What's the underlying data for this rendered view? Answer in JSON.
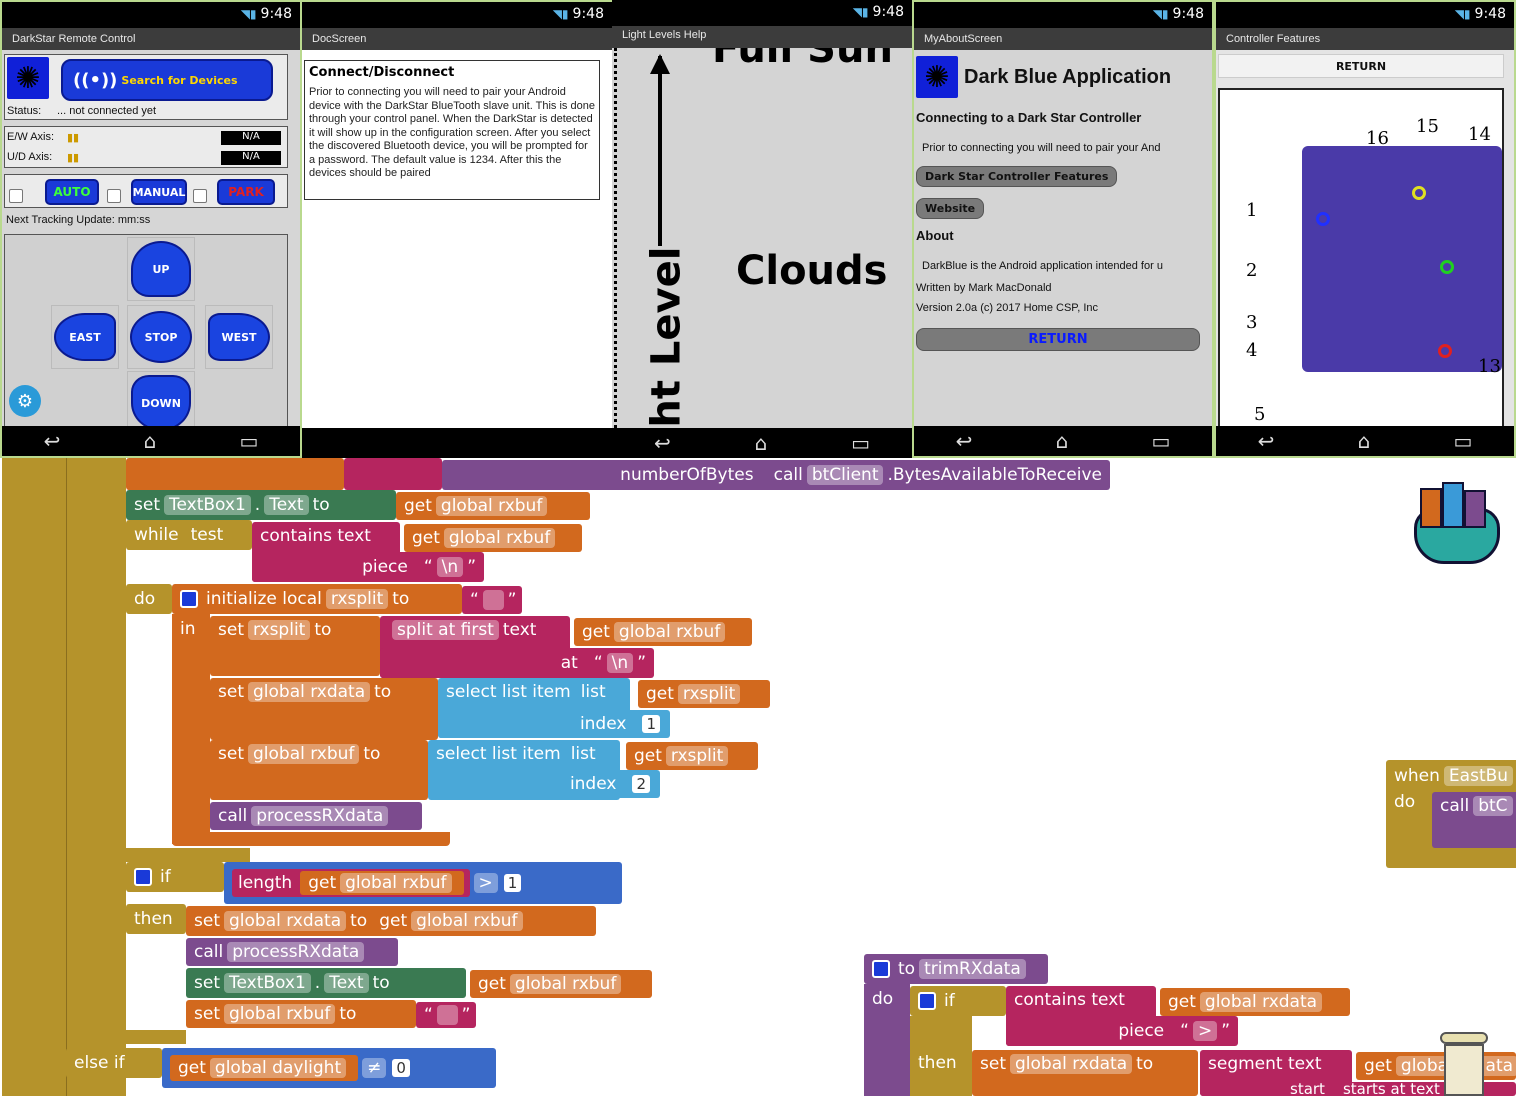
{
  "status_time": "9:48",
  "phones": {
    "remote": {
      "title": "DarkStar Remote Control",
      "search_label": "Search for Devices",
      "status_label": "Status:",
      "status_value": "... not connected yet",
      "ew_label": "E/W Axis:",
      "ud_label": "U/D Axis:",
      "ew_value": "N/A",
      "ud_value": "N/A",
      "auto_label": "AUTO",
      "manual_label": "MANUAL",
      "park_label": "PARK",
      "next_update": "Next Tracking Update: mm:ss",
      "up": "UP",
      "east": "EAST",
      "stop": "STOP",
      "west": "WEST",
      "down": "DOWN"
    },
    "doc": {
      "title": "DocScreen",
      "heading": "Connect/Disconnect",
      "body": "Prior to connecting you will need to pair your Android device with the DarkStar BlueTooth slave unit. This is done through your control panel. When the DarkStar is detected it will show up in the configuration screen. After you select the discovered Bluetooth device, you will be prompted for a password. The default value is 1234. After this the devices should be paired"
    },
    "light": {
      "title": "Light Levels Help",
      "top_text": "Full Sun",
      "clouds": "Clouds",
      "axis": "Light Level"
    },
    "about": {
      "title": "MyAboutScreen",
      "app_name": "Dark Blue Application",
      "connecting": "Connecting to a Dark Star Controller",
      "prior": "Prior to connecting you will need to pair your And",
      "features_btn": "Dark Star Controller Features",
      "website_btn": "Website",
      "about_head": "About",
      "about_body": "DarkBlue is the Android application intended for u",
      "written": "Written by Mark MacDonald",
      "version": "Version 2.0a (c) 2017 Home CSP, Inc",
      "return_btn": "RETURN"
    },
    "features": {
      "title": "Controller Features",
      "return_btn": "RETURN",
      "labels": [
        "1",
        "2",
        "3",
        "4",
        "5",
        "16",
        "15",
        "14",
        "13"
      ]
    }
  },
  "blocks": {
    "row0": [
      "numberOfBytes",
      "call",
      "btClient",
      ".BytesAvailableToReceive"
    ],
    "set_textbox": [
      "set",
      "TextBox1",
      ".",
      "Text",
      "to",
      "get",
      "global rxbuf"
    ],
    "while": [
      "while",
      "test",
      "contains text",
      "get",
      "global rxbuf"
    ],
    "piece": [
      "piece",
      "\\n"
    ],
    "do_init": [
      "do",
      "initialize local",
      "rxsplit",
      "to"
    ],
    "in_set": [
      "in",
      "set",
      "rxsplit",
      "to",
      "split at first",
      "text",
      "get",
      "global rxbuf"
    ],
    "at": [
      "at",
      "\\n"
    ],
    "set_rxdata": [
      "set",
      "global rxdata",
      "to",
      "select list item",
      "list",
      "get",
      "rxsplit"
    ],
    "index1": [
      "index",
      "1"
    ],
    "set_rxbuf": [
      "set",
      "global rxbuf",
      "to",
      "select list item",
      "list",
      "get",
      "rxsplit"
    ],
    "index2": [
      "index",
      "2"
    ],
    "call_process": [
      "call",
      "processRXdata"
    ],
    "if": [
      "if",
      "length",
      "get",
      "global rxbuf",
      ">",
      "1"
    ],
    "then": [
      "then",
      "set",
      "global rxdata",
      "to",
      "get",
      "global rxbuf"
    ],
    "call_process2": [
      "call",
      "processRXdata"
    ],
    "set_textbox2": [
      "set",
      "TextBox1",
      ".",
      "Text",
      "to",
      "get",
      "global rxbuf"
    ],
    "set_rxbuf_empty": [
      "set",
      "global rxbuf",
      "to"
    ],
    "elseif": [
      "else if",
      "get",
      "global daylight",
      "≠",
      "0"
    ],
    "when": [
      "when",
      "EastBu"
    ],
    "when_do": [
      "do",
      "call",
      "btC"
    ],
    "trim": [
      "to",
      "trimRXdata"
    ],
    "trim_do": [
      "do",
      "if",
      "contains text",
      "get",
      "global rxdata"
    ],
    "trim_piece": [
      "piece",
      ">"
    ],
    "trim_then": [
      "then",
      "set",
      "global rxdata",
      "to",
      "segment text",
      "get",
      "global rxdata"
    ],
    "trim_start": [
      "start",
      "starts at text"
    ]
  }
}
